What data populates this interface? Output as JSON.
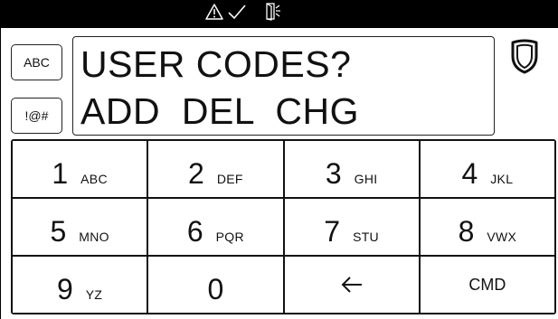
{
  "status_bar": {
    "icons": [
      "warning-icon",
      "check-icon",
      "door-open-icon"
    ]
  },
  "mode_buttons": {
    "abc_label": "ABC",
    "symbols_label": "!@#"
  },
  "display": {
    "line1": "USER CODES?",
    "line2": "ADD  DEL  CHG"
  },
  "shield_icon": "shield-icon",
  "keypad": {
    "keys": [
      {
        "digit": "1",
        "letters": "ABC"
      },
      {
        "digit": "2",
        "letters": "DEF"
      },
      {
        "digit": "3",
        "letters": "GHI"
      },
      {
        "digit": "4",
        "letters": "JKL"
      },
      {
        "digit": "5",
        "letters": "MNO"
      },
      {
        "digit": "6",
        "letters": "PQR"
      },
      {
        "digit": "7",
        "letters": "STU"
      },
      {
        "digit": "8",
        "letters": "VWX"
      },
      {
        "digit": "9",
        "letters": "YZ"
      },
      {
        "digit": "0",
        "letters": ""
      },
      {
        "icon": "back-arrow-icon"
      },
      {
        "label": "CMD"
      }
    ]
  }
}
